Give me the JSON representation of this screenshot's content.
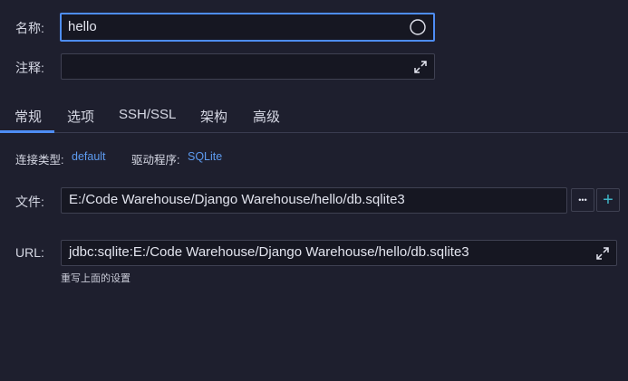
{
  "form": {
    "name_label": "名称:",
    "name_value": "hello",
    "comment_label": "注释:",
    "comment_value": ""
  },
  "tabs": [
    {
      "label": "常规",
      "active": true
    },
    {
      "label": "选项",
      "active": false
    },
    {
      "label": "SSH/SSL",
      "active": false
    },
    {
      "label": "架构",
      "active": false
    },
    {
      "label": "高级",
      "active": false
    }
  ],
  "connection": {
    "type_label": "连接类型:",
    "type_value": "default",
    "driver_label": "驱动程序:",
    "driver_value": "SQLite"
  },
  "file": {
    "label": "文件:",
    "value": "E:/Code Warehouse/Django Warehouse/hello/db.sqlite3",
    "browse_symbol": "•••",
    "add_symbol": "+"
  },
  "url": {
    "label": "URL:",
    "value": "jdbc:sqlite:E:/Code Warehouse/Django Warehouse/hello/db.sqlite3",
    "hint": "重写上面的设置"
  },
  "colors": {
    "accent": "#4e8df5",
    "link": "#5d9bf0",
    "background": "#1e1f2e",
    "field_background": "#161722",
    "add_button": "#3fb6c8"
  },
  "icons": {
    "name_status": "circle-icon",
    "comment_expand": "expand-icon",
    "url_expand": "expand-icon",
    "file_browse": "ellipsis-icon",
    "file_add": "plus-icon"
  }
}
